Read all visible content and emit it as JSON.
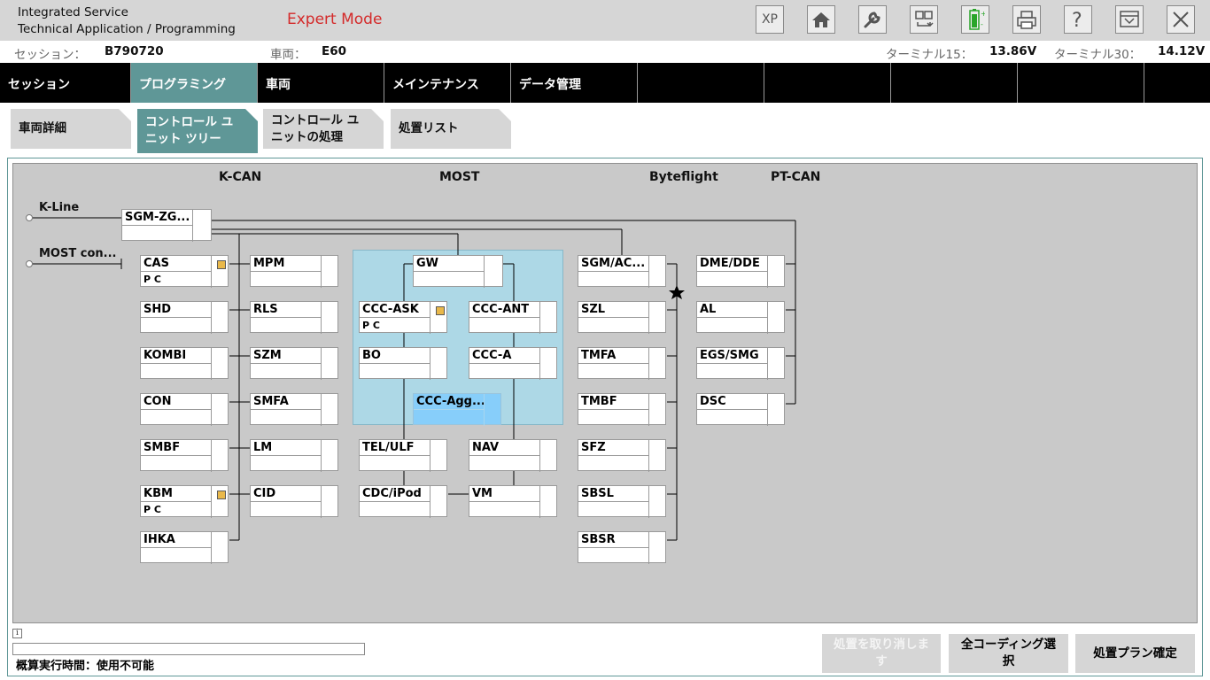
{
  "app": {
    "title_line1": "Integrated Service",
    "title_line2": "Technical Application / Programming",
    "mode": "Expert Mode"
  },
  "toolbar": {
    "xp": "XP",
    "buttons": [
      "xp",
      "home-icon",
      "wrench-icon",
      "connection-icon",
      "battery-icon",
      "printer-icon",
      "help-icon",
      "dropdown-icon",
      "close-icon"
    ],
    "battery_color": "#2aa52a"
  },
  "info": {
    "session_label": "セッション：",
    "session_value": "B790720",
    "vehicle_label": "車両：",
    "vehicle_value": "E60",
    "t15_label": "ターミナル15：",
    "t15_value": "13.86V",
    "t30_label": "ターミナル30：",
    "t30_value": "14.12V"
  },
  "main_tabs": [
    "セッション",
    "プログラミング",
    "車両",
    "メインテナンス",
    "データ管理"
  ],
  "sub_tabs": [
    "車両詳細",
    "コントロール ユ ニット ツリー",
    "コントロール ユ ニットの処理",
    "処置リスト"
  ],
  "sub_tab_lines": {
    "t2a": "コントロール ユ",
    "t2b": "ニット ツリー",
    "t3a": "コントロール ユ",
    "t3b": "ニットの処理"
  },
  "buses": {
    "kcan": "K-CAN",
    "most": "MOST",
    "byteflight": "Byteflight",
    "ptcan": "PT-CAN",
    "kline": "K-Line",
    "most_con": "MOST con..."
  },
  "units": {
    "sgm_zg": "SGM-ZG...",
    "cas": "CAS",
    "cas_sub": "P C",
    "shd": "SHD",
    "kombi": "KOMBI",
    "con": "CON",
    "smbf": "SMBF",
    "kbm": "KBM",
    "kbm_sub": "P C",
    "ihka": "IHKA",
    "mpm": "MPM",
    "rls": "RLS",
    "szm": "SZM",
    "smfa": "SMFA",
    "lm": "LM",
    "cid": "CID",
    "gw": "GW",
    "ccc_ask": "CCC-ASK",
    "ccc_ask_sub": "P C",
    "ccc_ant": "CCC-ANT",
    "bo": "BO",
    "ccc_a": "CCC-A",
    "ccc_agg": "CCC-Agg...",
    "tel_ulf": "TEL/ULF",
    "nav": "NAV",
    "cdc_ipod": "CDC/iPod",
    "vm": "VM",
    "sgm_ac": "SGM/AC...",
    "szl": "SZL",
    "tmfa": "TMFA",
    "tmbf": "TMBF",
    "sfz": "SFZ",
    "sbsl": "SBSL",
    "sbsr": "SBSR",
    "dme_dde": "DME/DDE",
    "al": "AL",
    "egs_smg": "EGS/SMG",
    "dsc": "DSC"
  },
  "bottom": {
    "info_icon": "i",
    "estimate": "概算実行時間：使用不可能",
    "btn_cancel_line1": "処置を取り消しま",
    "btn_cancel_line2": "す",
    "btn_all_coding_line1": "全コーディング選",
    "btn_all_coding_line2": "択",
    "btn_confirm": "処置プラン確定"
  },
  "colors": {
    "accent": "#5f9797",
    "mode_red": "#d42a2a",
    "most_box": "#add8e6",
    "flag": "#e9b84a"
  }
}
